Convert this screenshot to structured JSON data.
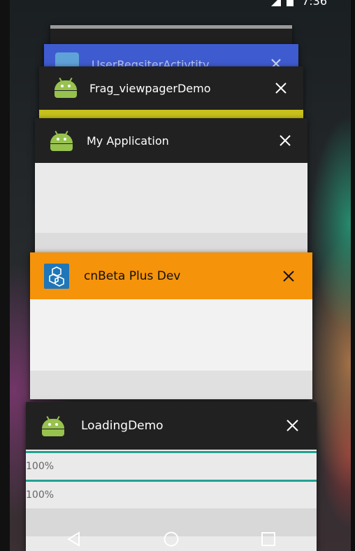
{
  "status_bar": {
    "time": "7:36"
  },
  "cards": [
    {
      "title": "",
      "icon": "android-robot-icon"
    },
    {
      "title": "UserRegsiterActivtity",
      "icon": "app-icon-globe",
      "accent": "#3f5bd0"
    },
    {
      "title": "Frag_viewpagerDemo",
      "icon": "android-robot-icon",
      "accent_strip": "#c8c21c"
    },
    {
      "title": "My Application",
      "icon": "android-robot-icon"
    },
    {
      "title": "cnBeta Plus Dev",
      "icon": "cnbeta-hexagon-icon",
      "accent": "#f5930a"
    },
    {
      "title": "LoadingDemo",
      "icon": "android-robot-icon",
      "progress_labels": [
        "100%",
        "100%"
      ],
      "progress_color": "#22a192"
    }
  ],
  "nav": {
    "back": "back-icon",
    "home": "home-icon",
    "recents": "recents-icon"
  },
  "colors": {
    "header_dark": "#212121",
    "content_light": "#eaeaea"
  }
}
